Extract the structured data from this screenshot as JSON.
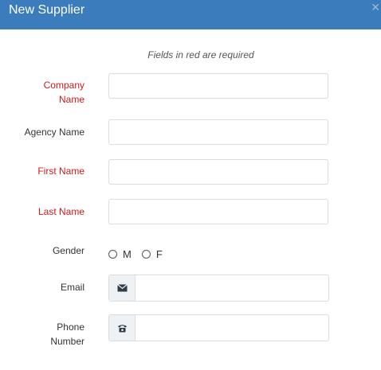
{
  "modal": {
    "title": "New Supplier",
    "close_icon": "close-icon",
    "note": "Fields in red are required"
  },
  "form": {
    "company_name": {
      "label_line1": "Company",
      "label_line2": "Name",
      "value": "",
      "required": true
    },
    "agency_name": {
      "label": "Agency Name",
      "value": "",
      "required": false
    },
    "first_name": {
      "label": "First Name",
      "value": "",
      "required": true
    },
    "last_name": {
      "label": "Last Name",
      "value": "",
      "required": true
    },
    "gender": {
      "label": "Gender",
      "options": [
        "M",
        "F"
      ],
      "selected": ""
    },
    "email": {
      "label": "Email",
      "icon": "envelope-icon",
      "value": ""
    },
    "phone": {
      "label_line1": "Phone",
      "label_line2": "Number",
      "icon": "phone-icon",
      "value": ""
    }
  },
  "colors": {
    "header": "#3a7cbc",
    "required_label": "#d0191c",
    "input_border": "#d7dde3",
    "addon_bg": "#eef2f5"
  }
}
